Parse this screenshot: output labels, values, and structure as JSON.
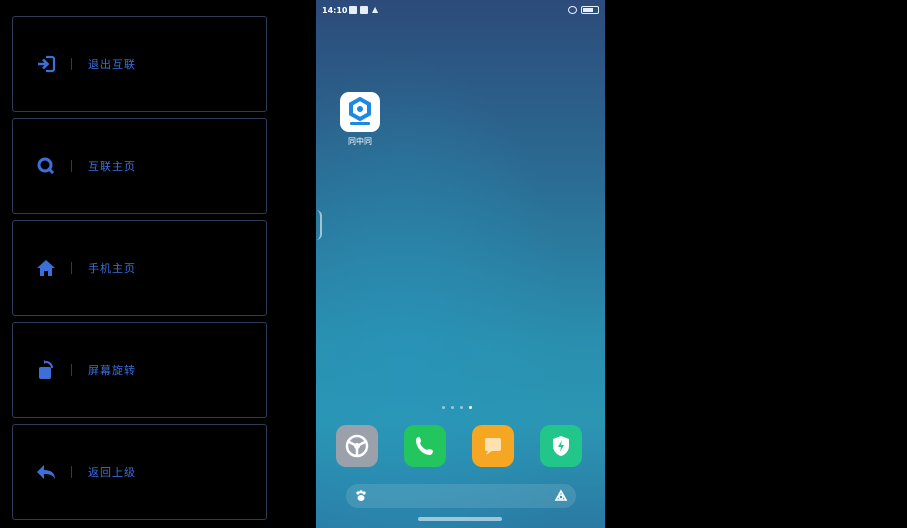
{
  "controls": [
    {
      "label": "退出互联",
      "icon": "exit-icon"
    },
    {
      "label": "互联主页",
      "icon": "search-icon"
    },
    {
      "label": "手机主页",
      "icon": "home-icon"
    },
    {
      "label": "屏幕旋转",
      "icon": "rotate-icon"
    },
    {
      "label": "返回上级",
      "icon": "back-arrow-icon"
    }
  ],
  "phone": {
    "status": {
      "time": "14:10"
    },
    "app": {
      "label": "同中同",
      "icon": "hexagon-app-icon"
    },
    "page_indicator": {
      "count": 4,
      "active": 3
    },
    "dock": [
      {
        "name": "settings",
        "icon": "wheel-icon",
        "color": "#9aa1ab"
      },
      {
        "name": "phone",
        "icon": "phone-icon",
        "color": "#22c55e"
      },
      {
        "name": "messages",
        "icon": "message-icon",
        "color": "#f5a623"
      },
      {
        "name": "security",
        "icon": "shield-icon",
        "color": "#22c58a"
      }
    ]
  },
  "colors": {
    "accent": "#3d6fd8",
    "panel_border": "#2c3d57"
  }
}
